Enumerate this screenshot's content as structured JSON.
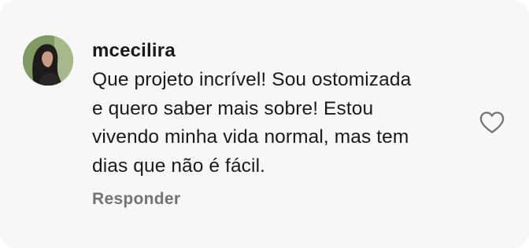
{
  "comment": {
    "username": "mcecilira",
    "lines": [
      "Que projeto incrível! Sou ostomizada",
      "e quero saber mais sobre! Estou",
      "vivendo minha vida normal, mas tem",
      "dias que não é fácil."
    ],
    "reply_label": "Responder",
    "avatar_icon": "profile-photo",
    "like_icon": "heart-outline-icon"
  }
}
